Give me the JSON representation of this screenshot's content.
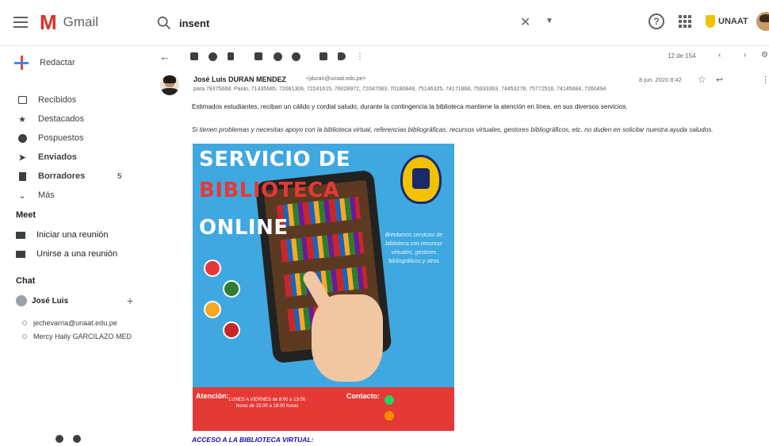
{
  "app": {
    "name": "Gmail"
  },
  "search": {
    "query": "insent"
  },
  "account": {
    "org": "UNAAT"
  },
  "sidebar": {
    "compose_label": "Redactar",
    "items": [
      {
        "label": "Recibidos",
        "count": ""
      },
      {
        "label": "Destacados",
        "count": ""
      },
      {
        "label": "Pospuestos",
        "count": ""
      },
      {
        "label": "Enviados",
        "count": ""
      },
      {
        "label": "Borradores",
        "count": "5"
      },
      {
        "label": "Más",
        "count": ""
      }
    ],
    "meet": {
      "title": "Meet",
      "items": [
        "Iniciar una reunión",
        "Unirse a una reunión"
      ]
    },
    "chat": {
      "title": "Chat",
      "user": "José Luis",
      "contacts": [
        "jechevarria@unaat.edu.pe",
        "Mercy Haily GARCILAZO MED"
      ]
    }
  },
  "toolbar": {
    "pager": "12 de 154"
  },
  "message": {
    "sender_name": "José Luis DURAN MENDEZ",
    "sender_email": "<jduran@unaat.edu.pe>",
    "recipients": "para 78375668, Paolo, 71435685, 72081306, 72241615, 76028972, 72047083, 70180848, 75146325, 74171868, 75933393, 74453278, 75772516, 74145684, 7260494",
    "date": "8 jun. 2020 8:42",
    "greeting": "Estimados estudiantes, reciban un cálido y cordial saludo, durante la contingencia la biblioteca mantiene la atención en línea, en sus diversos servicios.",
    "paragraph": "Si tienen problemas y necesitas apoyo con la biblioteca virtual, referencias bibliográficas, recursos virtuales, gestores bibliográficos, etc. no duden en solicitar nuestra ayuda saludos.",
    "footer_link": "ACCESO A LA BIBLIOTECA VIRTUAL:"
  },
  "poster": {
    "title_line1": "SERVICIO DE",
    "title_line2": "BIBLIOTECA",
    "title_line3": "ONLINE",
    "services_text": "Brindamos servicios de biblioteca con recursos virtuales, gestores bibliográficos y otros",
    "attention_label": "Atención:",
    "attention_text": "LUNES A VIERNES de 8:00 a 13:00 horas de 15:00 a 18:00 horas",
    "contact_label": "Contacto:",
    "colors": {
      "background": "#3fa8e0",
      "accent": "#e53935"
    }
  }
}
